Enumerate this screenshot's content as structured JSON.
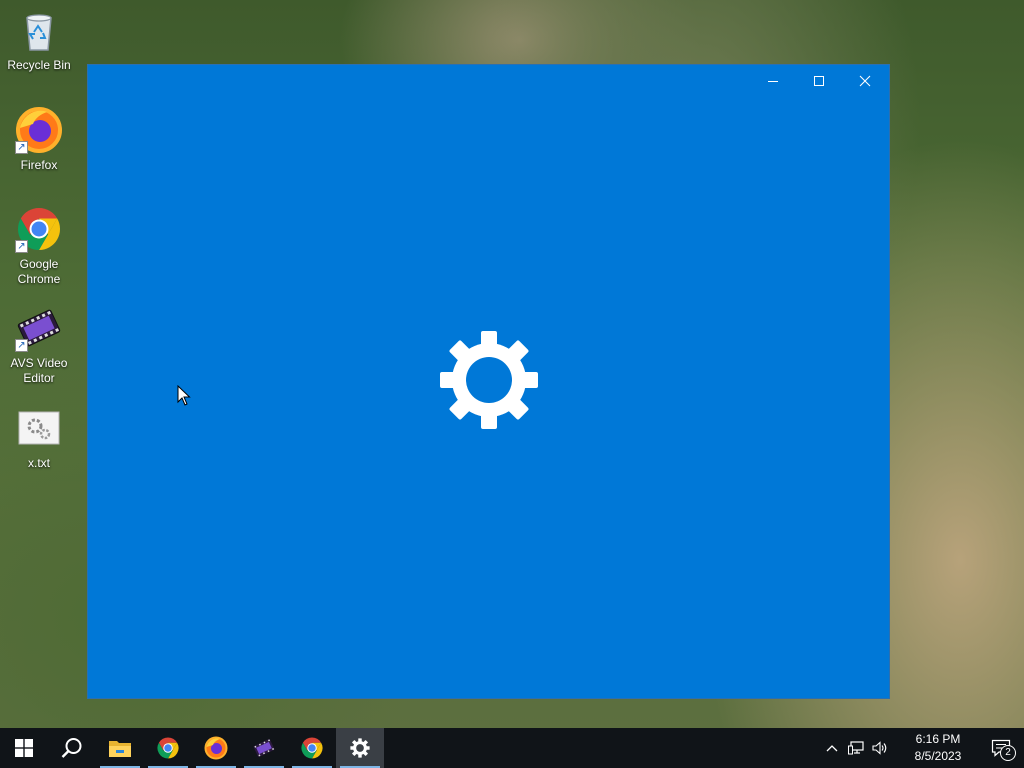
{
  "desktop": {
    "icons": [
      {
        "label": "Recycle Bin",
        "icon": "recycle-bin-icon"
      },
      {
        "label": "Firefox",
        "icon": "firefox-icon",
        "shortcut": true
      },
      {
        "label": "Google Chrome",
        "icon": "chrome-icon",
        "shortcut": true
      },
      {
        "label": "AVS Video Editor",
        "icon": "avs-video-editor-icon",
        "shortcut": true
      },
      {
        "label": "x.txt",
        "icon": "settings-file-icon"
      }
    ]
  },
  "window": {
    "app": "Settings",
    "background_color": "#0078d7",
    "splash_icon": "gear-icon",
    "controls": [
      "minimize-icon",
      "maximize-icon",
      "close-icon"
    ]
  },
  "taskbar": {
    "items": [
      {
        "icon": "windows-start-icon",
        "running": false
      },
      {
        "icon": "search-icon",
        "running": false
      },
      {
        "icon": "file-explorer-icon",
        "running": true
      },
      {
        "icon": "chrome-icon",
        "running": true
      },
      {
        "icon": "firefox-icon",
        "running": true
      },
      {
        "icon": "avs-video-editor-icon",
        "running": true
      },
      {
        "icon": "chrome-icon",
        "running": true
      },
      {
        "icon": "settings-gear-icon",
        "running": true,
        "active": true
      }
    ],
    "tray": {
      "icons": [
        "chevron-up-icon",
        "network-icon",
        "volume-icon"
      ],
      "time": "6:16 PM",
      "date": "8/5/2023",
      "notification_count": "2"
    }
  }
}
